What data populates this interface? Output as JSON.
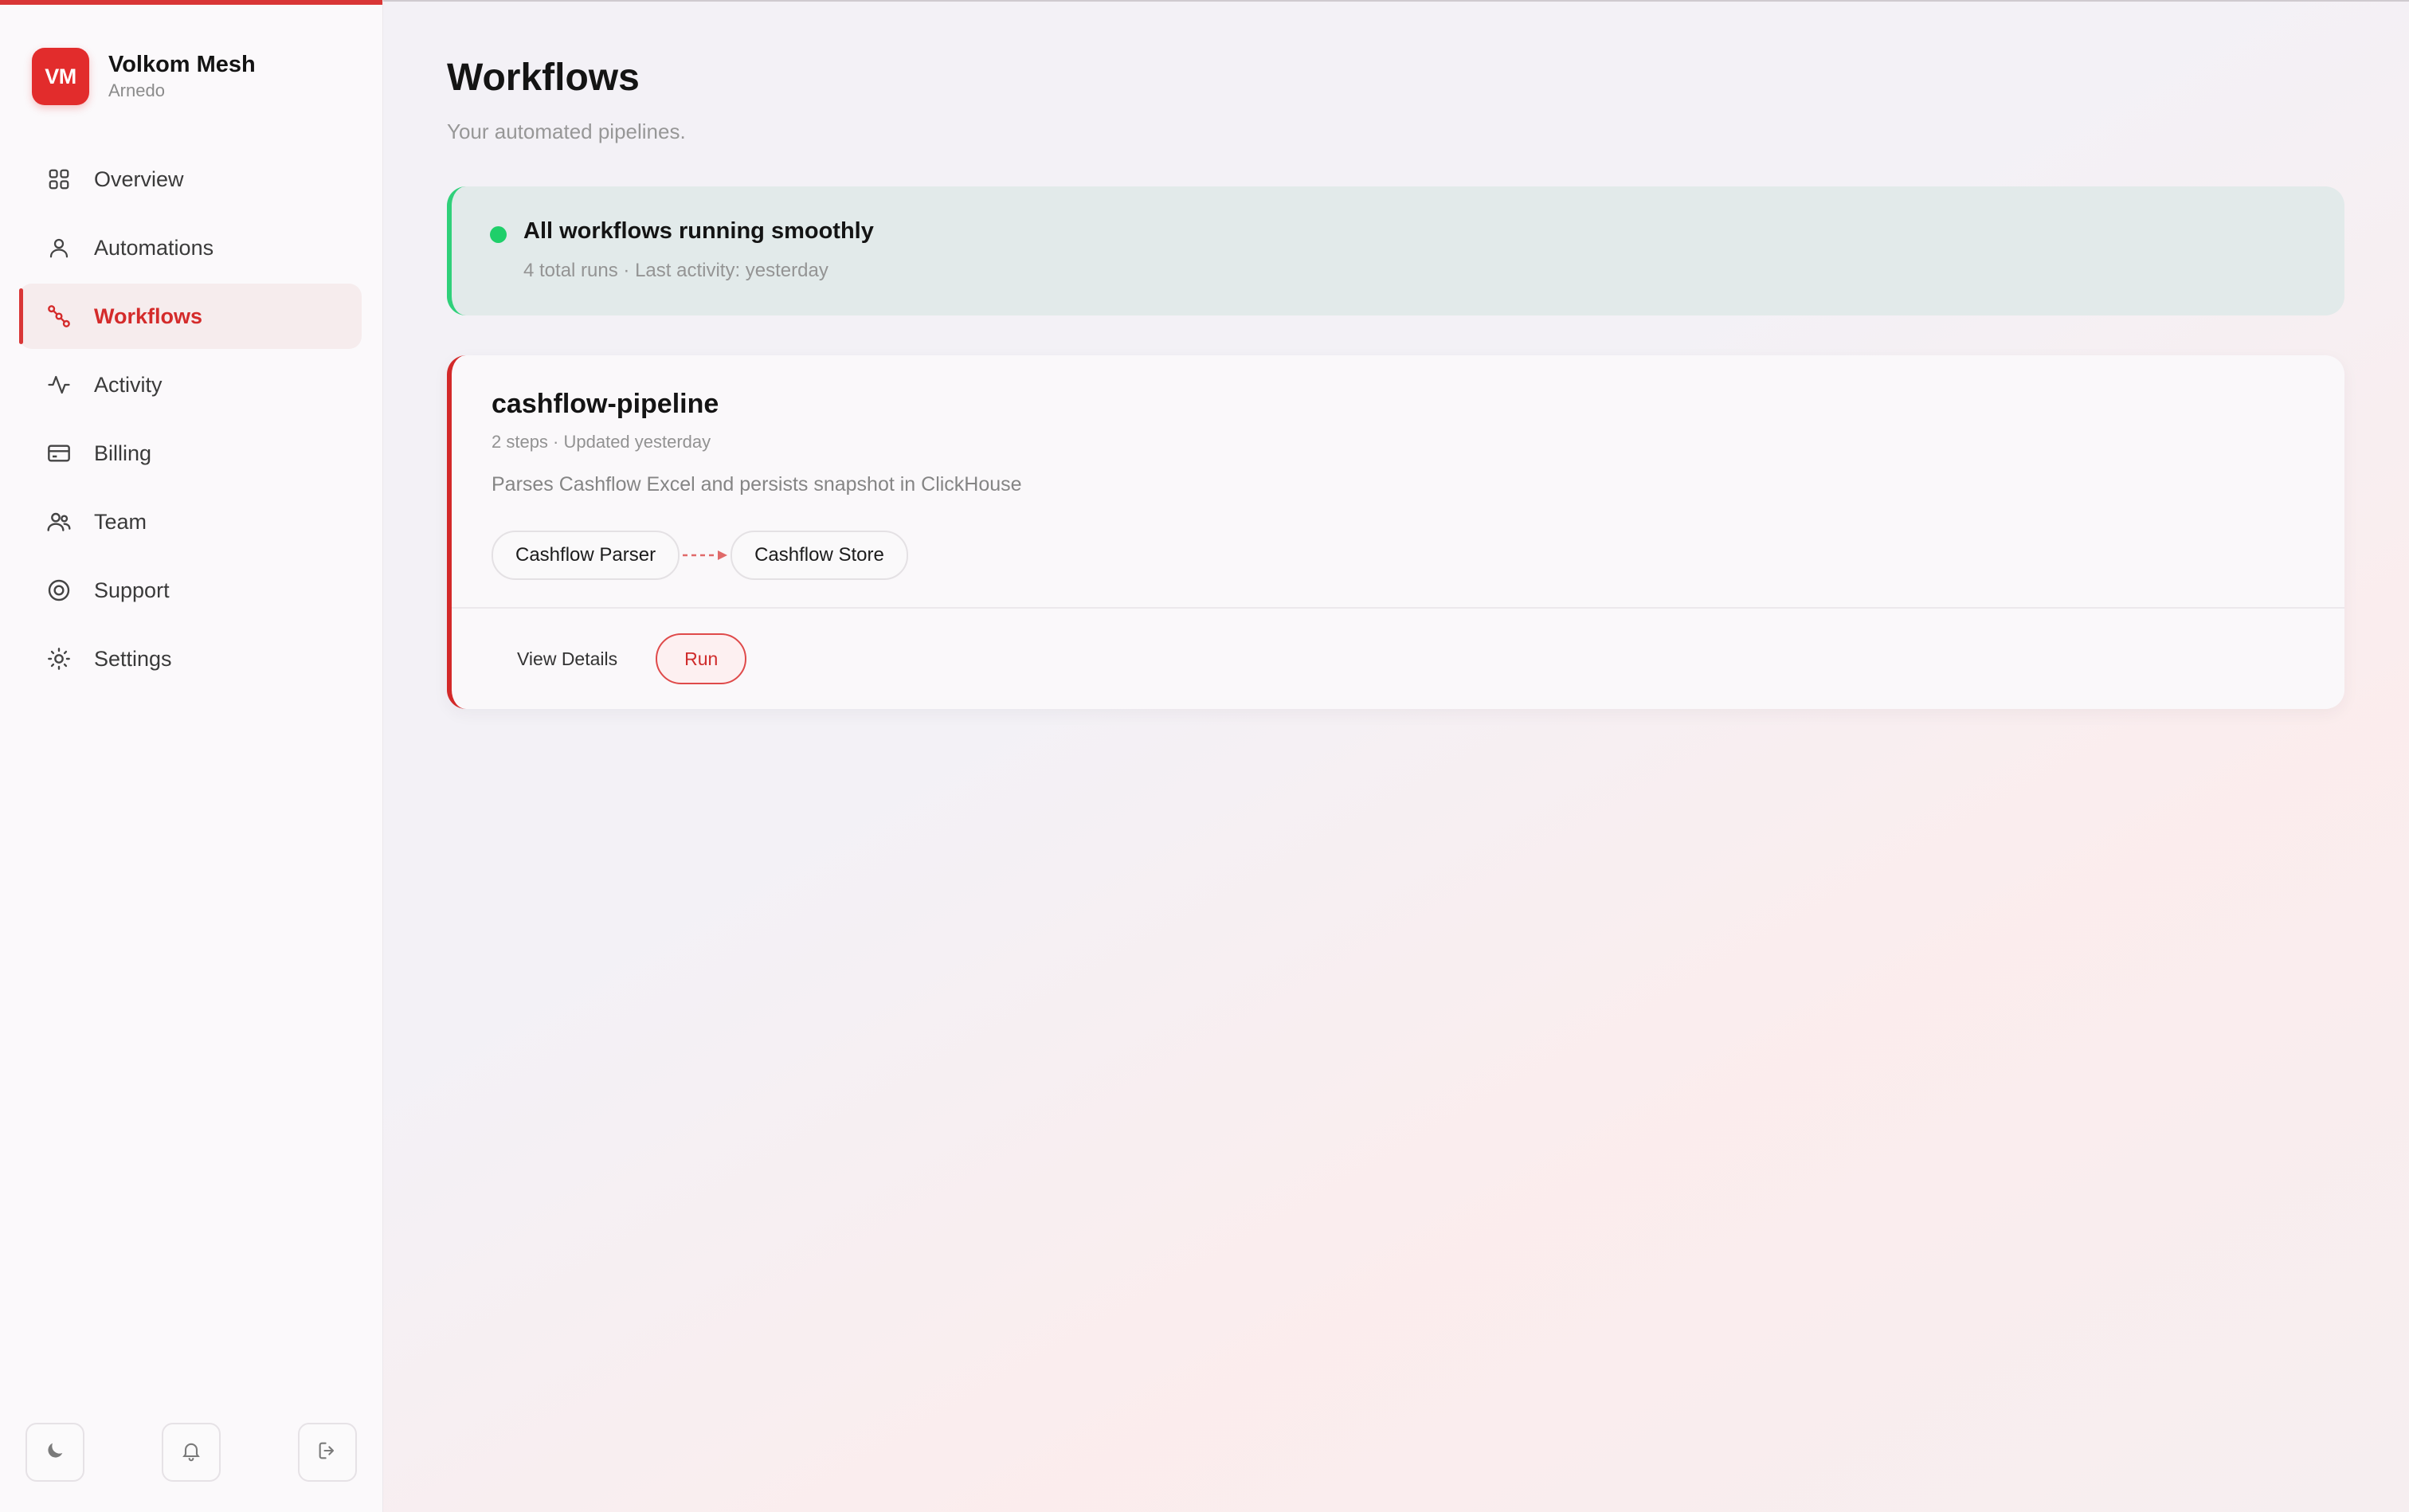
{
  "brand": {
    "initials": "VM",
    "name": "Volkom Mesh",
    "sub": "Arnedo"
  },
  "nav": {
    "items": [
      {
        "label": "Overview",
        "icon": "grid-icon",
        "active": false
      },
      {
        "label": "Automations",
        "icon": "user-icon",
        "active": false
      },
      {
        "label": "Workflows",
        "icon": "workflow-icon",
        "active": true
      },
      {
        "label": "Activity",
        "icon": "pulse-icon",
        "active": false
      },
      {
        "label": "Billing",
        "icon": "card-icon",
        "active": false
      },
      {
        "label": "Team",
        "icon": "team-icon",
        "active": false
      },
      {
        "label": "Support",
        "icon": "lifebuoy-icon",
        "active": false
      },
      {
        "label": "Settings",
        "icon": "sun-gear-icon",
        "active": false
      }
    ]
  },
  "sidebar_bottom": {
    "icons": [
      "moon-icon",
      "bell-icon",
      "logout-icon"
    ]
  },
  "page": {
    "title": "Workflows",
    "subtitle": "Your automated pipelines."
  },
  "status": {
    "title": "All workflows running smoothly",
    "meta": "4 total runs · Last activity: yesterday",
    "color": "#1fcf6a"
  },
  "workflow": {
    "name": "cashflow-pipeline",
    "meta": "2 steps · Updated yesterday",
    "description": "Parses Cashflow Excel and persists snapshot in ClickHouse",
    "steps": [
      "Cashflow Parser",
      "Cashflow Store"
    ],
    "actions": {
      "details_label": "View Details",
      "run_label": "Run"
    }
  },
  "colors": {
    "accent": "#d93636",
    "success": "#1fcf6a"
  }
}
